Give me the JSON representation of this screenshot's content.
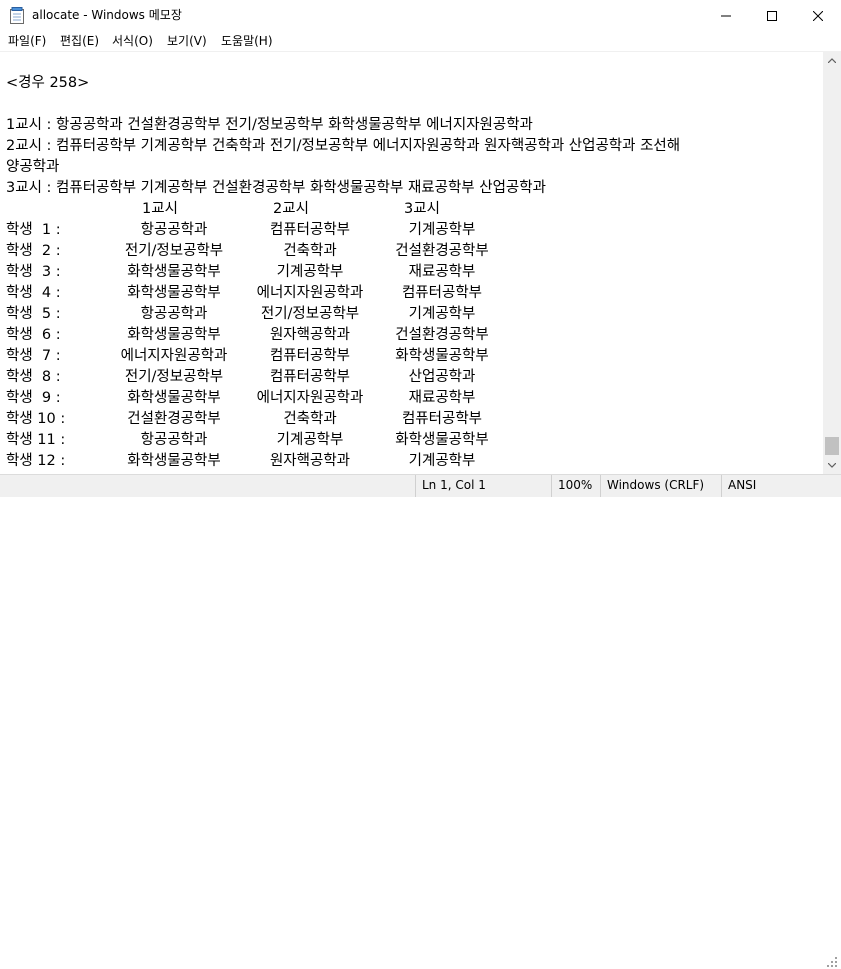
{
  "window": {
    "title": "allocate - Windows 메모장",
    "minimize": "minimize",
    "maximize": "maximize",
    "close": "close"
  },
  "menu": [
    {
      "label": "파일(F)"
    },
    {
      "label": "편집(E)"
    },
    {
      "label": "서식(O)"
    },
    {
      "label": "보기(V)"
    },
    {
      "label": "도움말(H)"
    }
  ],
  "editor": {
    "case_header": "<경우 258>",
    "period_lines": [
      "1교시 : 항공공학과 건설환경공학부 전기/정보공학부 화학생물공학부 에너지자원공학과",
      "2교시 : 컴퓨터공학부 기계공학부 건축학과 전기/정보공학부 에너지자원공학과 원자핵공학과 산업공학과 조선해",
      "양공학과",
      "3교시 : 컴퓨터공학부 기계공학부 건설환경공학부 화학생물공학부 재료공학부 산업공학과"
    ],
    "column_headers": [
      "1교시",
      "2교시",
      "3교시"
    ],
    "students": [
      {
        "label": "학생  1 :",
        "p1": "항공공학과",
        "p2": "컴퓨터공학부",
        "p3": "기계공학부"
      },
      {
        "label": "학생  2 :",
        "p1": "전기/정보공학부",
        "p2": "건축학과",
        "p3": "건설환경공학부"
      },
      {
        "label": "학생  3 :",
        "p1": "화학생물공학부",
        "p2": "기계공학부",
        "p3": "재료공학부"
      },
      {
        "label": "학생  4 :",
        "p1": "화학생물공학부",
        "p2": "에너지자원공학과",
        "p3": "컴퓨터공학부"
      },
      {
        "label": "학생  5 :",
        "p1": "항공공학과",
        "p2": "전기/정보공학부",
        "p3": "기계공학부"
      },
      {
        "label": "학생  6 :",
        "p1": "화학생물공학부",
        "p2": "원자핵공학과",
        "p3": "건설환경공학부"
      },
      {
        "label": "학생  7 :",
        "p1": "에너지자원공학과",
        "p2": "컴퓨터공학부",
        "p3": "화학생물공학부"
      },
      {
        "label": "학생  8 :",
        "p1": "전기/정보공학부",
        "p2": "컴퓨터공학부",
        "p3": "산업공학과"
      },
      {
        "label": "학생  9 :",
        "p1": "화학생물공학부",
        "p2": "에너지자원공학과",
        "p3": "재료공학부"
      },
      {
        "label": "학생 10 :",
        "p1": "건설환경공학부",
        "p2": "건축학과",
        "p3": "컴퓨터공학부"
      },
      {
        "label": "학생 11 :",
        "p1": "항공공학과",
        "p2": "기계공학부",
        "p3": "화학생물공학부"
      },
      {
        "label": "학생 12 :",
        "p1": "화학생물공학부",
        "p2": "원자핵공학과",
        "p3": "기계공학부"
      }
    ]
  },
  "status": {
    "position": "Ln 1, Col 1",
    "zoom": "100%",
    "line_ending": "Windows (CRLF)",
    "encoding": "ANSI"
  }
}
